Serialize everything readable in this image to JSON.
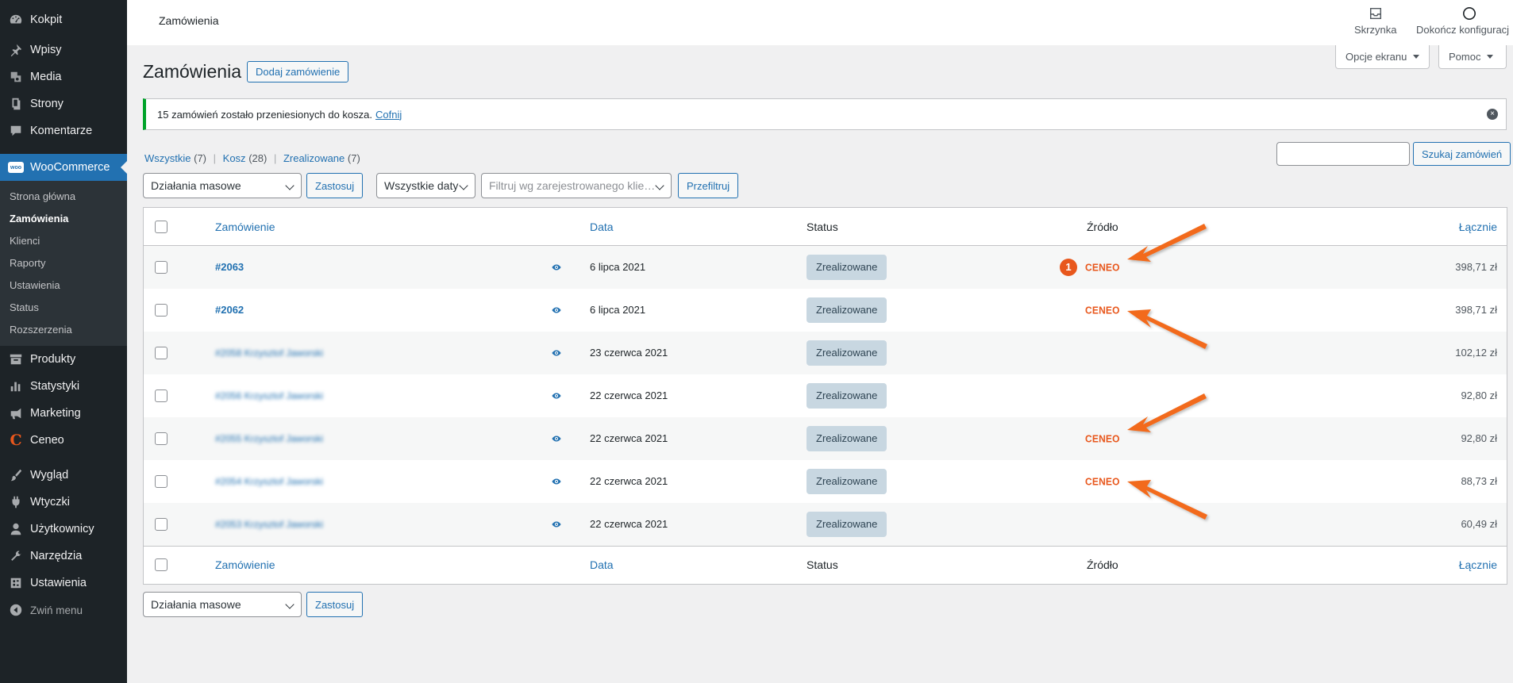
{
  "sidebar": {
    "items_top": [
      {
        "label": "Kokpit",
        "icon": "dashboard-icon"
      },
      {
        "label": "Wpisy",
        "icon": "pin-icon"
      },
      {
        "label": "Media",
        "icon": "media-icon"
      },
      {
        "label": "Strony",
        "icon": "pages-icon"
      },
      {
        "label": "Komentarze",
        "icon": "comments-icon"
      }
    ],
    "woocommerce": {
      "label": "WooCommerce",
      "icon": "woocommerce-icon",
      "badge": "woo"
    },
    "submenu": [
      "Strona główna",
      "Zamówienia",
      "Klienci",
      "Raporty",
      "Ustawienia",
      "Status",
      "Rozszerzenia"
    ],
    "items_mid": [
      {
        "label": "Produkty",
        "icon": "archive-icon"
      },
      {
        "label": "Statystyki",
        "icon": "chart-bar-icon"
      },
      {
        "label": "Marketing",
        "icon": "megaphone-icon"
      },
      {
        "label": "Ceneo",
        "icon": "ceneo-icon"
      }
    ],
    "items_bottom": [
      {
        "label": "Wygląd",
        "icon": "brush-icon"
      },
      {
        "label": "Wtyczki",
        "icon": "plugin-icon"
      },
      {
        "label": "Użytkownicy",
        "icon": "users-icon"
      },
      {
        "label": "Narzędzia",
        "icon": "wrench-icon"
      },
      {
        "label": "Ustawienia",
        "icon": "settings-icon"
      }
    ],
    "collapse_label": "Zwiń menu"
  },
  "header": {
    "title": "Zamówienia",
    "inbox_label": "Skrzynka",
    "setup_label": "Dokończ konfiguracj",
    "screen_options": "Opcje ekranu",
    "help": "Pomoc"
  },
  "page": {
    "title": "Zamówienia",
    "add_button": "Dodaj zamówienie"
  },
  "notice": {
    "text": "15 zamówień zostało przeniesionych do kosza.",
    "undo": "Cofnij"
  },
  "filters": {
    "views": [
      {
        "label": "Wszystkie",
        "count": "(7)"
      },
      {
        "label": "Kosz",
        "count": "(28)"
      },
      {
        "label": "Zrealizowane",
        "count": "(7)"
      }
    ],
    "bulk_actions": "Działania masowe",
    "apply": "Zastosuj",
    "dates": "Wszystkie daty",
    "customer_placeholder": "Filtruj wg zarejestrowanego klie…",
    "filter_button": "Przefiltruj",
    "search_button": "Szukaj zamówień",
    "search_value": ""
  },
  "table": {
    "columns": {
      "order": "Zamówienie",
      "date": "Data",
      "status": "Status",
      "source": "Źródło",
      "total": "Łącznie"
    },
    "rows": [
      {
        "order": "#2063",
        "blurred": false,
        "date": "6 lipca 2021",
        "status": "Zrealizowane",
        "source": "CENEO",
        "badge": "1",
        "total": "398,71 zł"
      },
      {
        "order": "#2062",
        "blurred": false,
        "date": "6 lipca 2021",
        "status": "Zrealizowane",
        "source": "CENEO",
        "badge": "",
        "total": "398,71 zł"
      },
      {
        "order": "#2058 Krzysztof Jaworski",
        "blurred": true,
        "date": "23 czerwca 2021",
        "status": "Zrealizowane",
        "source": "",
        "badge": "",
        "total": "102,12 zł"
      },
      {
        "order": "#2056 Krzysztof Jaworski",
        "blurred": true,
        "date": "22 czerwca 2021",
        "status": "Zrealizowane",
        "source": "",
        "badge": "",
        "total": "92,80 zł"
      },
      {
        "order": "#2055 Krzysztof Jaworski",
        "blurred": true,
        "date": "22 czerwca 2021",
        "status": "Zrealizowane",
        "source": "CENEO",
        "badge": "",
        "total": "92,80 zł"
      },
      {
        "order": "#2054 Krzysztof Jaworski",
        "blurred": true,
        "date": "22 czerwca 2021",
        "status": "Zrealizowane",
        "source": "CENEO",
        "badge": "",
        "total": "88,73 zł"
      },
      {
        "order": "#2053 Krzysztof Jaworski",
        "blurred": true,
        "date": "22 czerwca 2021",
        "status": "Zrealizowane",
        "source": "",
        "badge": "",
        "total": "60,49 zł"
      }
    ]
  },
  "colors": {
    "accent": "#2271b1",
    "sidebar_bg": "#1d2327",
    "notice_success": "#00a32a",
    "ceneo_orange": "#e8571c",
    "status_completed_bg": "#c8d7e1"
  }
}
